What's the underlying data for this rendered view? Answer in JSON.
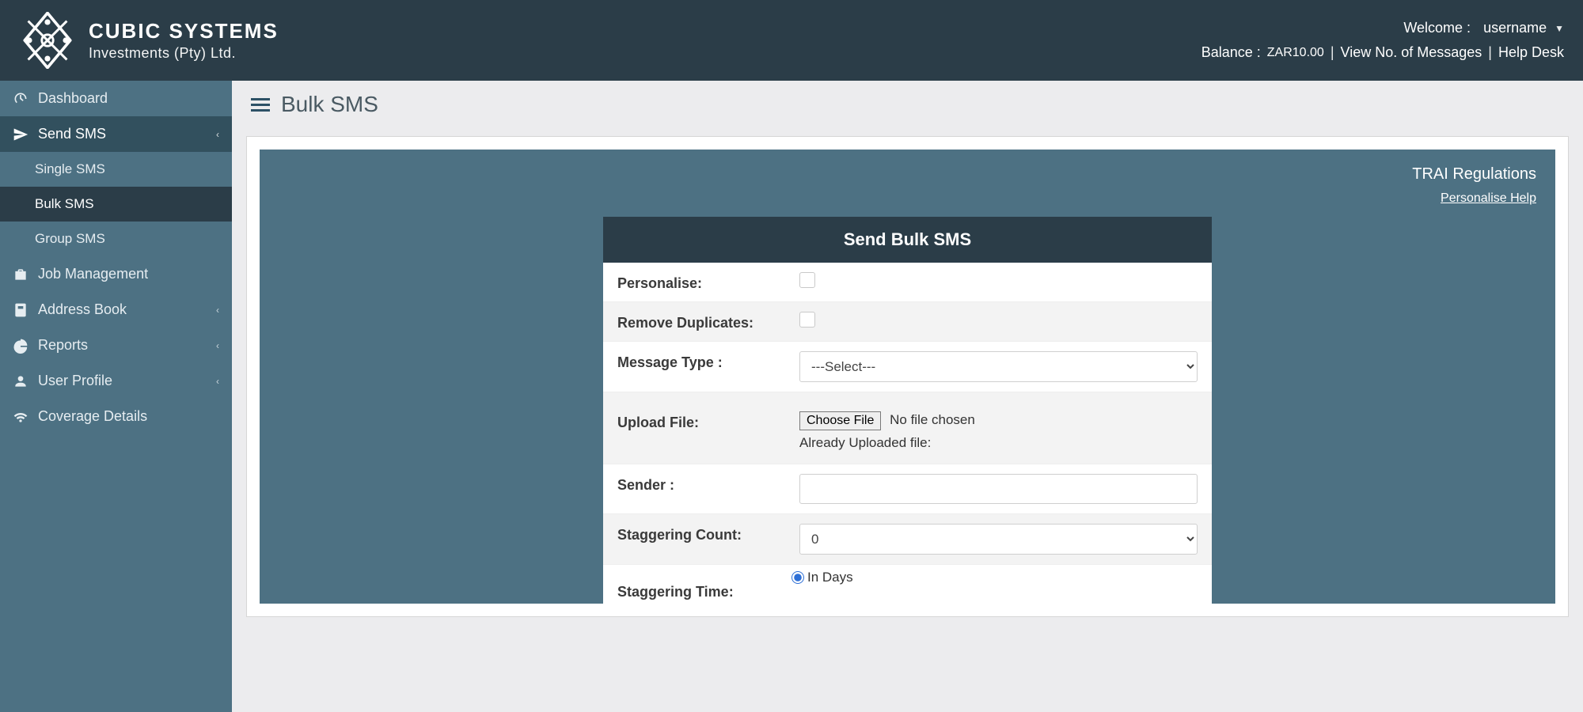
{
  "header": {
    "brand_line1": "CUBIC SYSTEMS",
    "brand_line2": "Investments (Pty) Ltd.",
    "welcome_label": "Welcome :",
    "username": "username",
    "balance_label": "Balance :",
    "balance_value": "ZAR10.00",
    "view_messages": "View No. of Messages",
    "help_desk": "Help Desk",
    "separator": "|"
  },
  "sidebar": {
    "items": [
      {
        "label": "Dashboard",
        "icon": "gauge"
      },
      {
        "label": "Send SMS",
        "icon": "send",
        "expanded": true
      },
      {
        "label": "Single SMS",
        "sub": true
      },
      {
        "label": "Bulk SMS",
        "sub": true,
        "selected": true
      },
      {
        "label": "Group SMS",
        "sub": true
      },
      {
        "label": "Job Management",
        "icon": "briefcase"
      },
      {
        "label": "Address Book",
        "icon": "book",
        "chevron": true
      },
      {
        "label": "Reports",
        "icon": "pie",
        "chevron": true
      },
      {
        "label": "User Profile",
        "icon": "user",
        "chevron": true
      },
      {
        "label": "Coverage Details",
        "icon": "wifi"
      }
    ]
  },
  "page": {
    "title": "Bulk SMS",
    "regulations": "TRAI Regulations",
    "personalise_help": "Personalise Help"
  },
  "form": {
    "title": "Send Bulk SMS",
    "personalise_label": "Personalise:",
    "remove_dup_label": "Remove Duplicates:",
    "message_type_label": "Message Type :",
    "message_type_select": "---Select---",
    "upload_file_label": "Upload File:",
    "choose_file_btn": "Choose File",
    "choose_file_status": "No file chosen",
    "already_uploaded": "Already Uploaded file:",
    "sender_label": "Sender :",
    "sender_value": "",
    "staggering_count_label": "Staggering Count:",
    "staggering_count_value": "0",
    "staggering_time_label": "Staggering Time:",
    "staggering_time_option": "In Days"
  }
}
